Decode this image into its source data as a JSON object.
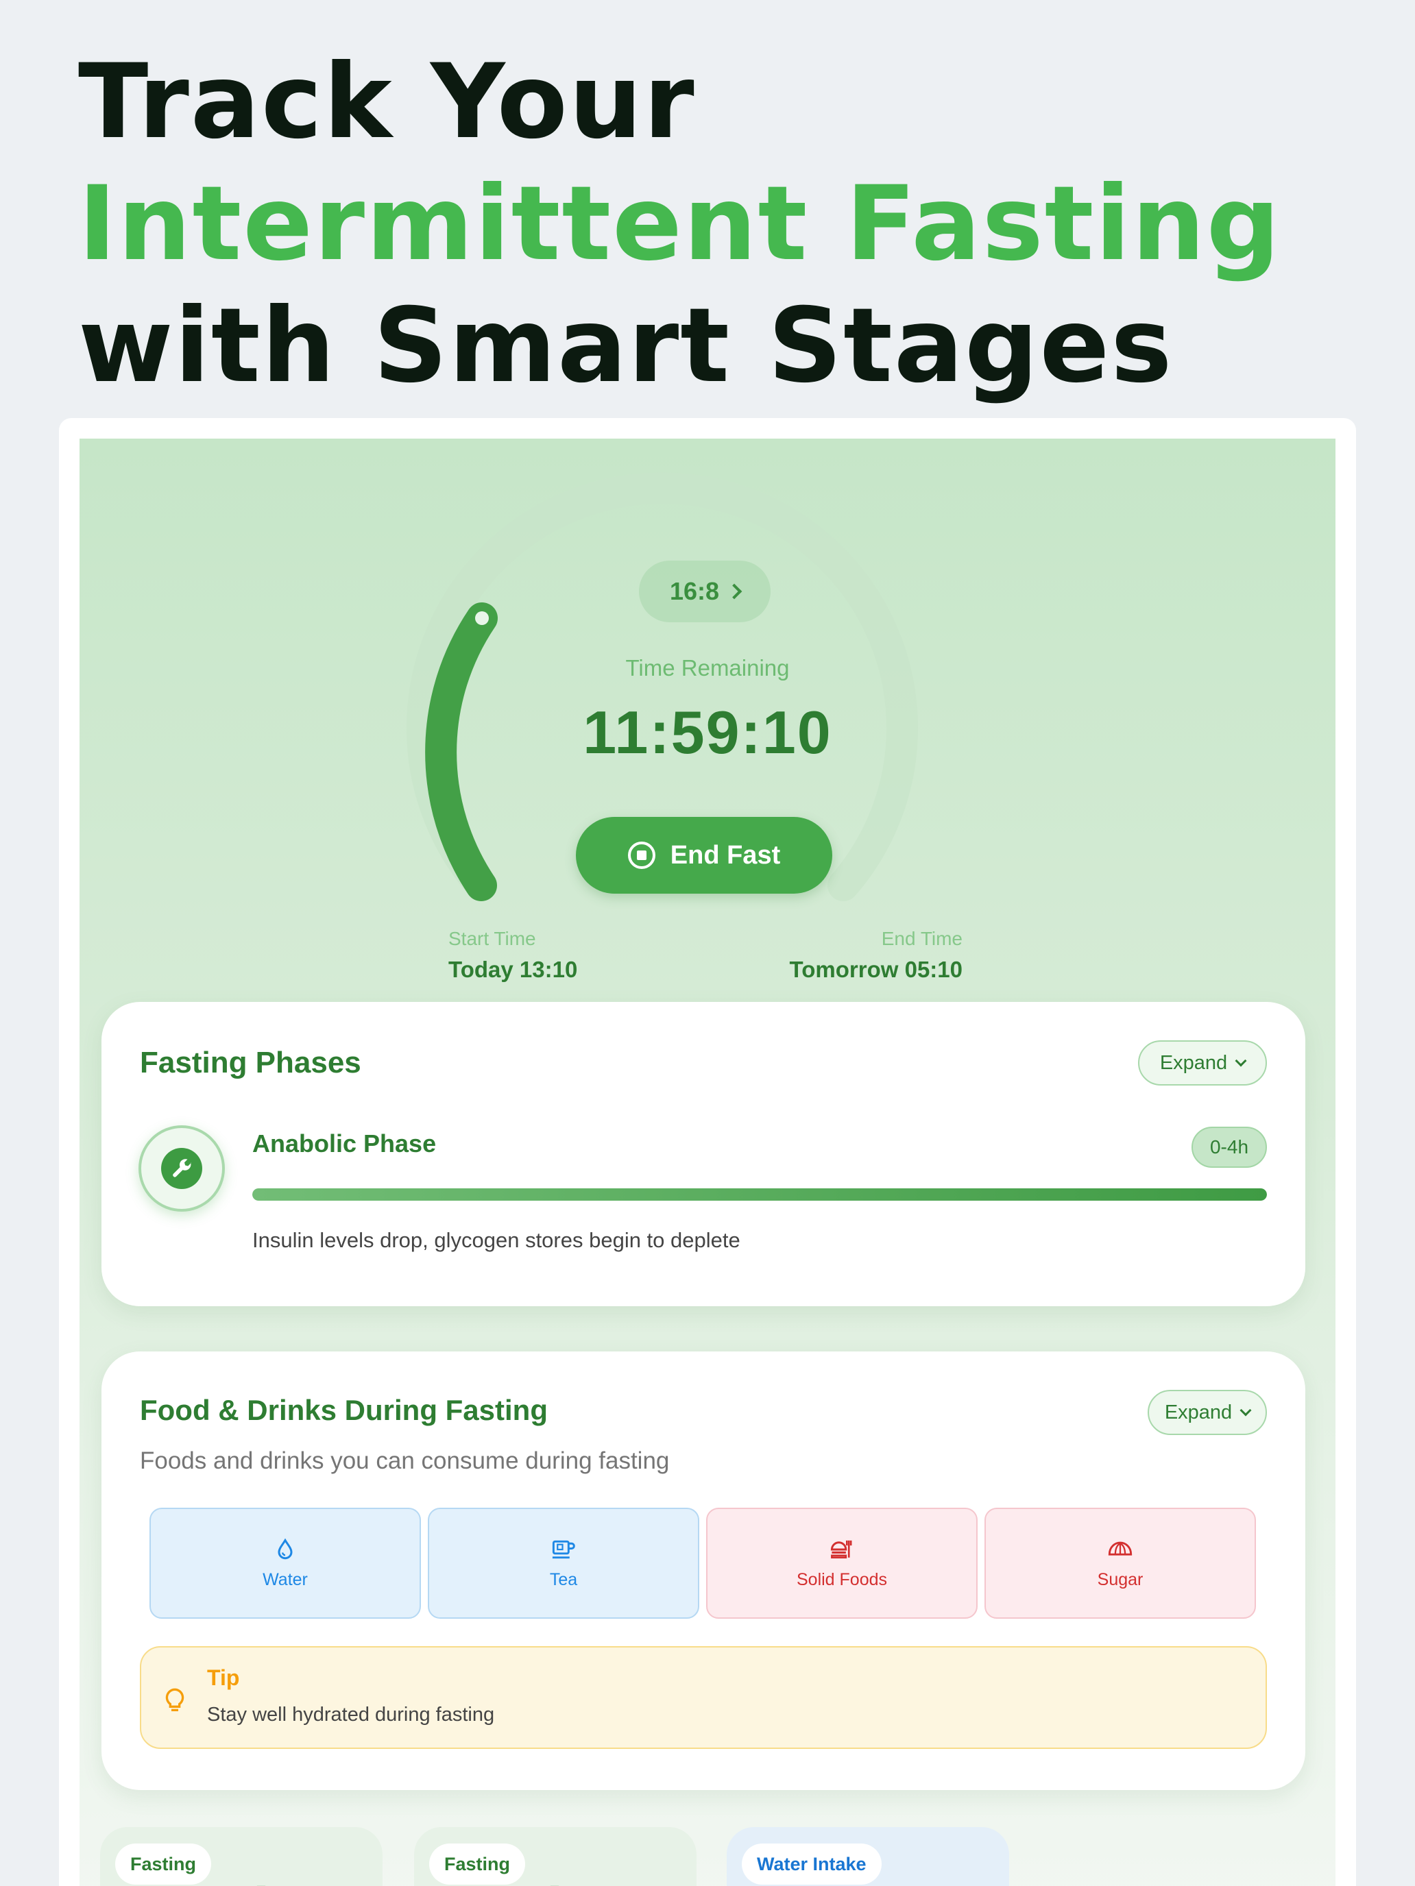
{
  "headline": {
    "line1": "Track Your",
    "line2": "Intermittent Fasting",
    "line3": "with Smart Stages"
  },
  "colors": {
    "accent": "#45b84f",
    "primary_dark": "#2e7d32",
    "button": "#45a94b",
    "allowed": "#1e88e5",
    "forbidden": "#d32f2f",
    "tip": "#f59e0b"
  },
  "timer": {
    "plan": "16:8",
    "label": "Time Remaining",
    "remaining": "11:59:10",
    "progress_fraction": 0.25,
    "end_button": "End Fast",
    "start_label": "Start Time",
    "start_value": "Today 13:10",
    "end_label": "End Time",
    "end_value": "Tomorrow 05:10"
  },
  "phases": {
    "title": "Fasting Phases",
    "expand": "Expand",
    "current": {
      "name": "Anabolic Phase",
      "range": "0-4h",
      "progress_percent": 100,
      "description": "Insulin levels drop, glycogen stores begin to deplete",
      "icon": "wrench-icon"
    }
  },
  "food": {
    "title": "Food & Drinks During Fasting",
    "expand": "Expand",
    "subtitle": "Foods and drinks you can consume during fasting",
    "items": [
      {
        "label": "Water",
        "icon": "water-drop-icon",
        "allowed": true
      },
      {
        "label": "Tea",
        "icon": "tea-cup-icon",
        "allowed": true
      },
      {
        "label": "Solid Foods",
        "icon": "food-icon",
        "allowed": false
      },
      {
        "label": "Sugar",
        "icon": "croissant-icon",
        "allowed": false
      }
    ],
    "tip": {
      "title": "Tip",
      "text": "Stay well hydrated during fasting",
      "icon": "lightbulb-icon"
    }
  },
  "stats": [
    {
      "label": "Fasting",
      "icon": "stopwatch-icon"
    },
    {
      "label": "Fasting",
      "icon": "stopwatch-icon"
    },
    {
      "label": "Water Intake",
      "icon": "water-drop-icon"
    }
  ]
}
